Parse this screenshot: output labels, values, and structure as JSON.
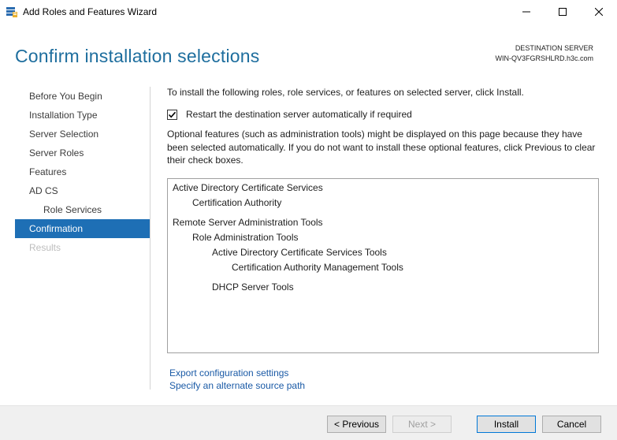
{
  "window": {
    "title": "Add Roles and Features Wizard",
    "icon": "server-manager-icon",
    "controls": [
      "minimize-icon",
      "maximize-icon",
      "close-icon"
    ]
  },
  "header": {
    "page_title": "Confirm installation selections",
    "destination_label": "DESTINATION SERVER",
    "destination_value": "WIN-QV3FGRSHLRD.h3c.com"
  },
  "nav": {
    "items": [
      {
        "label": "Before You Begin",
        "state": "normal"
      },
      {
        "label": "Installation Type",
        "state": "normal"
      },
      {
        "label": "Server Selection",
        "state": "normal"
      },
      {
        "label": "Server Roles",
        "state": "normal"
      },
      {
        "label": "Features",
        "state": "normal"
      },
      {
        "label": "AD CS",
        "state": "normal"
      },
      {
        "label": "Role Services",
        "state": "sub"
      },
      {
        "label": "Confirmation",
        "state": "active"
      },
      {
        "label": "Results",
        "state": "disabled"
      }
    ]
  },
  "content": {
    "intro": "To install the following roles, role services, or features on selected server, click Install.",
    "restart_label": "Restart the destination server automatically if required",
    "restart_checked": true,
    "optional_note": "Optional features (such as administration tools) might be displayed on this page because they have been selected automatically. If you do not want to install these optional features, click Previous to clear their check boxes."
  },
  "selections": [
    {
      "label": "Active Directory Certificate Services",
      "level": 0
    },
    {
      "label": "Certification Authority",
      "level": 1
    },
    {
      "label": "Remote Server Administration Tools",
      "level": 0
    },
    {
      "label": "Role Administration Tools",
      "level": 1
    },
    {
      "label": "Active Directory Certificate Services Tools",
      "level": 2
    },
    {
      "label": "Certification Authority Management Tools",
      "level": 3
    },
    {
      "label": "DHCP Server Tools",
      "level": 2
    }
  ],
  "links": {
    "export": "Export configuration settings",
    "alternate_source": "Specify an alternate source path"
  },
  "buttons": {
    "previous": "< Previous",
    "next": "Next >",
    "install": "Install",
    "cancel": "Cancel"
  },
  "colors": {
    "accent_blue": "#1e6fb5",
    "title_blue": "#1e6e9e",
    "link_blue": "#1a5aa6"
  }
}
